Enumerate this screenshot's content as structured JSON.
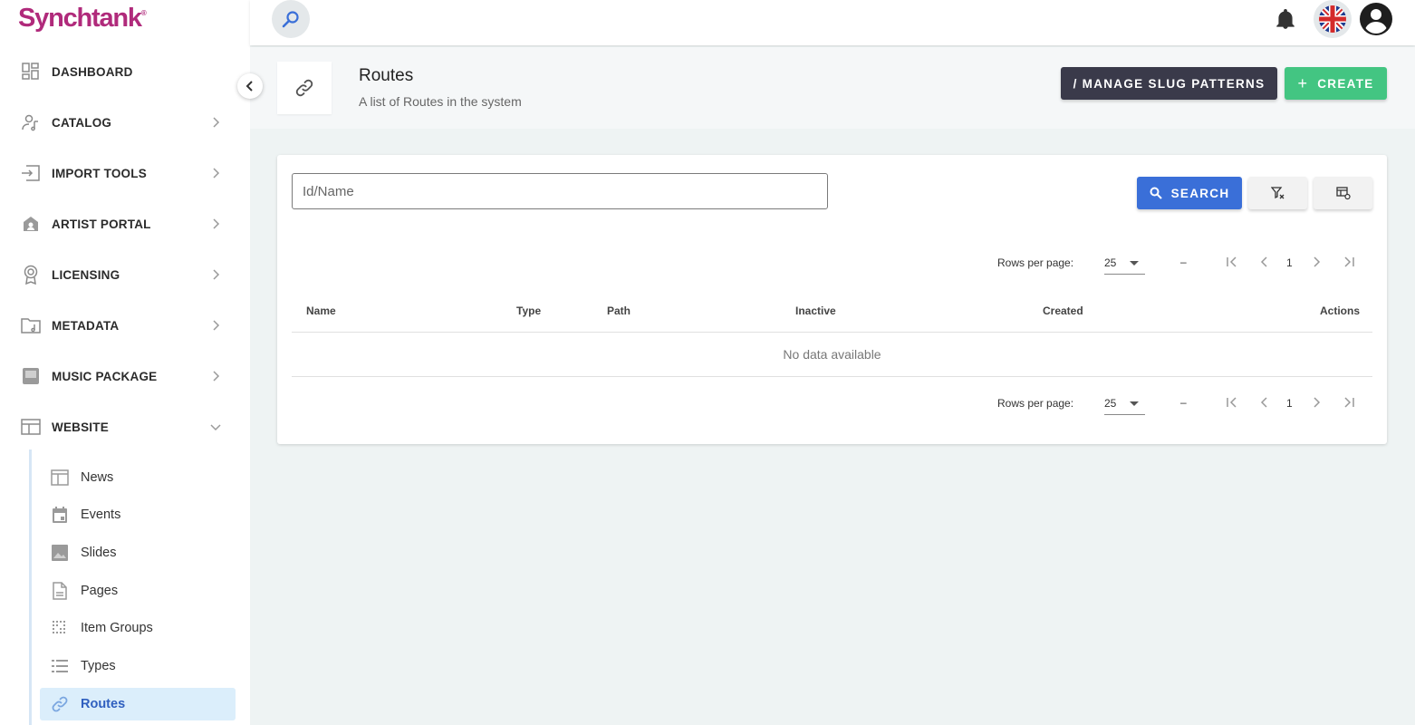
{
  "app": {
    "logo": "Synchtank",
    "logo_mark": "®"
  },
  "sidebar": {
    "items": [
      {
        "label": "DASHBOARD",
        "icon": "dashboard-icon"
      },
      {
        "label": "CATALOG",
        "icon": "catalog-icon"
      },
      {
        "label": "IMPORT TOOLS",
        "icon": "import-icon"
      },
      {
        "label": "ARTIST PORTAL",
        "icon": "artist-portal-icon"
      },
      {
        "label": "LICENSING",
        "icon": "licensing-icon"
      },
      {
        "label": "METADATA",
        "icon": "metadata-icon"
      },
      {
        "label": "MUSIC PACKAGE",
        "icon": "music-package-icon"
      },
      {
        "label": "WEBSITE",
        "icon": "website-icon"
      }
    ],
    "website_subitems": [
      {
        "label": "News",
        "icon": "news-icon"
      },
      {
        "label": "Events",
        "icon": "events-icon"
      },
      {
        "label": "Slides",
        "icon": "slides-icon"
      },
      {
        "label": "Pages",
        "icon": "pages-icon"
      },
      {
        "label": "Item Groups",
        "icon": "item-groups-icon"
      },
      {
        "label": "Types",
        "icon": "types-icon"
      },
      {
        "label": "Routes",
        "icon": "link-icon",
        "active": true
      }
    ]
  },
  "header": {
    "title": "Routes",
    "subtitle": "A list of Routes in the system",
    "manage_button": "/ MANAGE SLUG PATTERNS",
    "create_button": "CREATE",
    "create_icon": "+"
  },
  "filters": {
    "search_placeholder": "Id/Name",
    "search_button": "SEARCH"
  },
  "pagination": {
    "rows_label": "Rows per page:",
    "rows_value": "25",
    "range": "–",
    "page": "1"
  },
  "table": {
    "columns": [
      "Name",
      "Type",
      "Path",
      "Inactive",
      "Created",
      "Actions"
    ],
    "empty_text": "No data available"
  },
  "colors": {
    "brand": "#b02a7b",
    "primary": "#3a6fd8",
    "create": "#43c582",
    "dark_button": "#3a3a4a",
    "active_bg": "#dbeefb"
  }
}
